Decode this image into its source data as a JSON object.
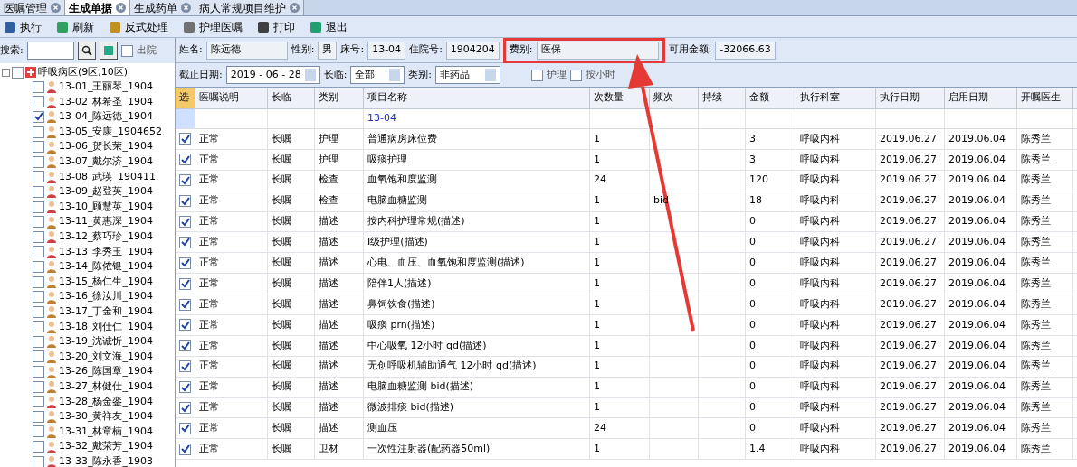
{
  "tabs": [
    {
      "label": "医嘱管理",
      "selected": false
    },
    {
      "label": "生成单据",
      "selected": true
    },
    {
      "label": "生成药单",
      "selected": false
    },
    {
      "label": "病人常规项目维护",
      "selected": false
    }
  ],
  "toolbar": [
    "执行",
    "刷新",
    "反式处理",
    "护理医嘱",
    "打印",
    "退出"
  ],
  "search": {
    "label": "搜索:",
    "checkbox_label": "出院",
    "checked": false
  },
  "patient": [
    {
      "label": "姓名:",
      "value": "陈远德"
    },
    {
      "label": "性别:",
      "value": "男"
    },
    {
      "label": "床号:",
      "value": "13-04"
    },
    {
      "label": "住院号:",
      "value": "1904204"
    },
    {
      "label": "费别:",
      "value": "医保"
    },
    {
      "label": "可用金额:",
      "value": "-32066.63"
    }
  ],
  "filters": {
    "date_label": "截止日期:",
    "date": "2019 - 06 - 28",
    "long_label": "长临:",
    "long": "全部",
    "type_label": "类别:",
    "type": "非药品",
    "nursing": {
      "label": "护理",
      "checked": false
    },
    "hourly": {
      "label": "按小时",
      "checked": false
    }
  },
  "tree": {
    "label": "呼吸病区(9区,10区)",
    "checked": false,
    "children": [
      {
        "label": "13-01_王丽琴_1904",
        "checked": false,
        "kind": "female"
      },
      {
        "label": "13-02_林希圣_1904",
        "checked": false,
        "kind": "female"
      },
      {
        "label": "13-04_陈远德_1904",
        "checked": true,
        "kind": "male"
      },
      {
        "label": "13-05_安康_1904652",
        "checked": false,
        "kind": "male"
      },
      {
        "label": "13-06_贺长荣_1904",
        "checked": false,
        "kind": "male"
      },
      {
        "label": "13-07_戴尔济_1904",
        "checked": false,
        "kind": "male"
      },
      {
        "label": "13-08_武瑛_190411",
        "checked": false,
        "kind": "female"
      },
      {
        "label": "13-09_赵登英_1904",
        "checked": false,
        "kind": "female"
      },
      {
        "label": "13-10_顾慧英_1904",
        "checked": false,
        "kind": "female"
      },
      {
        "label": "13-11_黄惠深_1904",
        "checked": false,
        "kind": "male"
      },
      {
        "label": "13-12_蔡巧珍_1904",
        "checked": false,
        "kind": "female"
      },
      {
        "label": "13-13_李秀玉_1904",
        "checked": false,
        "kind": "female"
      },
      {
        "label": "13-14_陈侬银_1904",
        "checked": false,
        "kind": "male"
      },
      {
        "label": "13-15_杨仁生_1904",
        "checked": false,
        "kind": "male"
      },
      {
        "label": "13-16_徐汝川_1904",
        "checked": false,
        "kind": "male"
      },
      {
        "label": "13-17_丁金和_1904",
        "checked": false,
        "kind": "male"
      },
      {
        "label": "13-18_刘仕仁_1904",
        "checked": false,
        "kind": "male"
      },
      {
        "label": "13-19_沈诚忻_1904",
        "checked": false,
        "kind": "male"
      },
      {
        "label": "13-20_刘文海_1904",
        "checked": false,
        "kind": "male"
      },
      {
        "label": "13-26_陈国章_1904",
        "checked": false,
        "kind": "male"
      },
      {
        "label": "13-27_林健仕_1904",
        "checked": false,
        "kind": "male"
      },
      {
        "label": "13-28_杨金銮_1904",
        "checked": false,
        "kind": "female"
      },
      {
        "label": "13-30_黄祥友_1904",
        "checked": false,
        "kind": "male"
      },
      {
        "label": "13-31_林章楠_1904",
        "checked": false,
        "kind": "male"
      },
      {
        "label": "13-32_戴荣芳_1904",
        "checked": false,
        "kind": "female"
      },
      {
        "label": "13-33_陈永香_1903",
        "checked": false,
        "kind": "female"
      }
    ]
  },
  "table": {
    "select_column": "选",
    "columns": [
      "医嘱说明",
      "长临",
      "类别",
      "项目名称",
      "次数量",
      "频次",
      "持续",
      "金额",
      "执行科室",
      "执行日期",
      "启用日期",
      "开嘱医生"
    ],
    "group": "13-04",
    "rows": [
      {
        "checked": true,
        "cells": [
          "正常",
          "长嘱",
          "护理",
          "普通病房床位费",
          "1",
          "",
          "",
          "3",
          "呼吸内科",
          "2019.06.27",
          "2019.06.04",
          "陈秀兰"
        ]
      },
      {
        "checked": true,
        "cells": [
          "正常",
          "长嘱",
          "护理",
          "吸痰护理",
          "1",
          "",
          "",
          "3",
          "呼吸内科",
          "2019.06.27",
          "2019.06.04",
          "陈秀兰"
        ]
      },
      {
        "checked": true,
        "cells": [
          "正常",
          "长嘱",
          "检查",
          "血氧饱和度监测",
          "24",
          "",
          "",
          "120",
          "呼吸内科",
          "2019.06.27",
          "2019.06.04",
          "陈秀兰"
        ]
      },
      {
        "checked": true,
        "cells": [
          "正常",
          "长嘱",
          "检查",
          "电脑血糖监测",
          "1",
          "bid",
          "",
          "18",
          "呼吸内科",
          "2019.06.27",
          "2019.06.04",
          "陈秀兰"
        ]
      },
      {
        "checked": true,
        "cells": [
          "正常",
          "长嘱",
          "描述",
          "按内科护理常规(描述)",
          "1",
          "",
          "",
          "0",
          "呼吸内科",
          "2019.06.27",
          "2019.06.04",
          "陈秀兰"
        ]
      },
      {
        "checked": true,
        "cells": [
          "正常",
          "长嘱",
          "描述",
          "I级护理(描述)",
          "1",
          "",
          "",
          "0",
          "呼吸内科",
          "2019.06.27",
          "2019.06.04",
          "陈秀兰"
        ]
      },
      {
        "checked": true,
        "cells": [
          "正常",
          "长嘱",
          "描述",
          "心电、血压、血氧饱和度监测(描述)",
          "1",
          "",
          "",
          "0",
          "呼吸内科",
          "2019.06.27",
          "2019.06.04",
          "陈秀兰"
        ]
      },
      {
        "checked": true,
        "cells": [
          "正常",
          "长嘱",
          "描述",
          "陪伴1人(描述)",
          "1",
          "",
          "",
          "0",
          "呼吸内科",
          "2019.06.27",
          "2019.06.04",
          "陈秀兰"
        ]
      },
      {
        "checked": true,
        "cells": [
          "正常",
          "长嘱",
          "描述",
          "鼻饲饮食(描述)",
          "1",
          "",
          "",
          "0",
          "呼吸内科",
          "2019.06.27",
          "2019.06.04",
          "陈秀兰"
        ]
      },
      {
        "checked": true,
        "cells": [
          "正常",
          "长嘱",
          "描述",
          "吸痰 prn(描述)",
          "1",
          "",
          "",
          "0",
          "呼吸内科",
          "2019.06.27",
          "2019.06.04",
          "陈秀兰"
        ]
      },
      {
        "checked": true,
        "cells": [
          "正常",
          "长嘱",
          "描述",
          "中心吸氧 12小时 qd(描述)",
          "1",
          "",
          "",
          "0",
          "呼吸内科",
          "2019.06.27",
          "2019.06.04",
          "陈秀兰"
        ]
      },
      {
        "checked": true,
        "cells": [
          "正常",
          "长嘱",
          "描述",
          "无创呼吸机辅助通气 12小时 qd(描述)",
          "1",
          "",
          "",
          "0",
          "呼吸内科",
          "2019.06.27",
          "2019.06.04",
          "陈秀兰"
        ]
      },
      {
        "checked": true,
        "cells": [
          "正常",
          "长嘱",
          "描述",
          "电脑血糖监测 bid(描述)",
          "1",
          "",
          "",
          "0",
          "呼吸内科",
          "2019.06.27",
          "2019.06.04",
          "陈秀兰"
        ]
      },
      {
        "checked": true,
        "cells": [
          "正常",
          "长嘱",
          "描述",
          "微波排痰 bid(描述)",
          "1",
          "",
          "",
          "0",
          "呼吸内科",
          "2019.06.27",
          "2019.06.04",
          "陈秀兰"
        ]
      },
      {
        "checked": true,
        "cells": [
          "正常",
          "长嘱",
          "描述",
          "测血压",
          "24",
          "",
          "",
          "0",
          "呼吸内科",
          "2019.06.27",
          "2019.06.04",
          "陈秀兰"
        ]
      },
      {
        "checked": true,
        "cells": [
          "正常",
          "长嘱",
          "卫材",
          "一次性注射器(配药器50ml)",
          "1",
          "",
          "",
          "1.4",
          "呼吸内科",
          "2019.06.27",
          "2019.06.04",
          "陈秀兰"
        ]
      }
    ]
  }
}
